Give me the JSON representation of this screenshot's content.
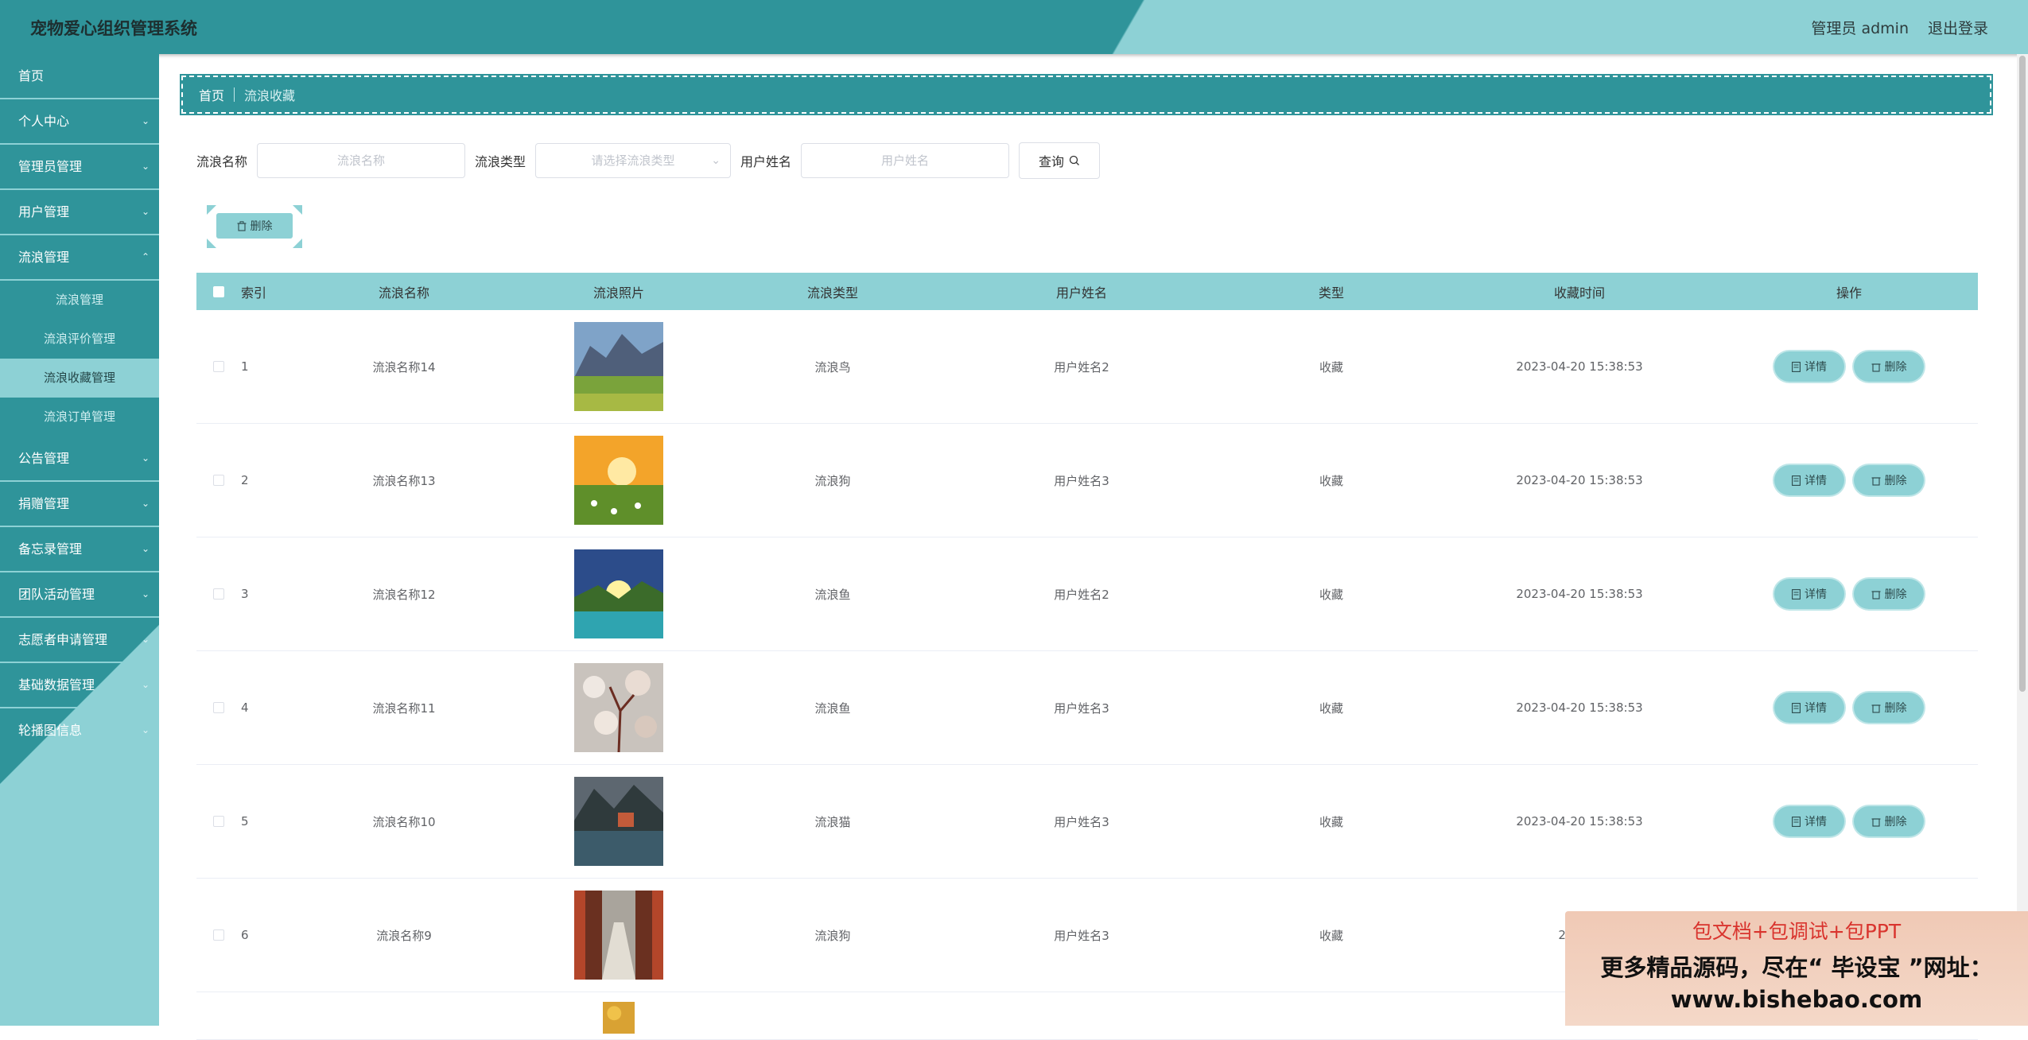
{
  "header": {
    "title": "宠物爱心组织管理系统",
    "user": "管理员 admin",
    "logout": "退出登录"
  },
  "sidebar": {
    "items": [
      {
        "label": "首页",
        "chevron": false
      },
      {
        "label": "个人中心",
        "chevron": true
      },
      {
        "label": "管理员管理",
        "chevron": true
      },
      {
        "label": "用户管理",
        "chevron": true
      },
      {
        "label": "流浪管理",
        "chevron": true,
        "expanded": true
      }
    ],
    "subitems": [
      "流浪管理",
      "流浪评价管理",
      "流浪收藏管理",
      "流浪订单管理"
    ],
    "active_subitem": "流浪收藏管理",
    "items_after": [
      "公告管理",
      "捐赠管理",
      "备忘录管理",
      "团队活动管理",
      "志愿者申请管理",
      "基础数据管理",
      "轮播图信息"
    ]
  },
  "breadcrumb": {
    "home": "首页",
    "current": "流浪收藏"
  },
  "search": {
    "name_label": "流浪名称",
    "name_placeholder": "流浪名称",
    "type_label": "流浪类型",
    "type_placeholder": "请选择流浪类型",
    "user_label": "用户姓名",
    "user_placeholder": "用户姓名",
    "query_button": "查询"
  },
  "toolbar": {
    "delete_label": "删除"
  },
  "table": {
    "headers": [
      "索引",
      "流浪名称",
      "流浪照片",
      "流浪类型",
      "用户姓名",
      "类型",
      "收藏时间",
      "操作"
    ],
    "detail_label": "详情",
    "delete_label": "删除",
    "rows": [
      {
        "index": "1",
        "name": "流浪名称14",
        "type": "流浪鸟",
        "user": "用户姓名2",
        "kind": "收藏",
        "time": "2023-04-20 15:38:53"
      },
      {
        "index": "2",
        "name": "流浪名称13",
        "type": "流浪狗",
        "user": "用户姓名3",
        "kind": "收藏",
        "time": "2023-04-20 15:38:53"
      },
      {
        "index": "3",
        "name": "流浪名称12",
        "type": "流浪鱼",
        "user": "用户姓名2",
        "kind": "收藏",
        "time": "2023-04-20 15:38:53"
      },
      {
        "index": "4",
        "name": "流浪名称11",
        "type": "流浪鱼",
        "user": "用户姓名3",
        "kind": "收藏",
        "time": "2023-04-20 15:38:53"
      },
      {
        "index": "5",
        "name": "流浪名称10",
        "type": "流浪猫",
        "user": "用户姓名3",
        "kind": "收藏",
        "time": "2023-04-20 15:38:53"
      },
      {
        "index": "6",
        "name": "流浪名称9",
        "type": "流浪狗",
        "user": "用户姓名3",
        "kind": "收藏",
        "time": "2023-0"
      }
    ]
  },
  "watermark": {
    "line1": "包文档+包调试+包PPT",
    "line2": "更多精品源码，尽在“ 毕设宝 ”网址：",
    "line3": "www.bishebao.com"
  },
  "colors": {
    "primary": "#2f949a",
    "accent": "#8dd1d5"
  }
}
